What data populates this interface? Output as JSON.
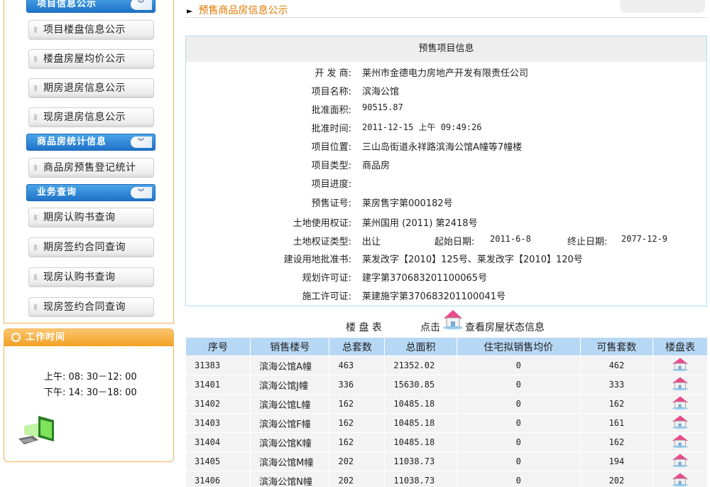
{
  "sidebar": {
    "sections": [
      {
        "title": "项目信息公示",
        "items": [
          "项目楼盘信息公示",
          "楼盘房屋均价公示",
          "期房退房信息公示",
          "现房退房信息公示"
        ]
      },
      {
        "title": "商品房统计信息",
        "items": [
          "商品房预售登记统计"
        ]
      },
      {
        "title": "业务查询",
        "items": [
          "期房认购书查询",
          "期房签约合同查询",
          "现房认购书查询",
          "现房签约合同查询"
        ]
      }
    ],
    "work_time": {
      "title": "工作时间",
      "morning": "上午: 08: 30－12: 00",
      "afternoon": "下午: 14: 30－18: 00"
    }
  },
  "main": {
    "breadcrumb": "预售商品房信息公示",
    "info": {
      "title": "预售项目信息",
      "developer_label": "开 发 商:",
      "developer": "莱州市金德电力房地产开发有限责任公司",
      "name_label": "项目名称:",
      "name": "滨海公馆",
      "area_label": "批准面积:",
      "area": "90515.87",
      "time_label": "批准时间:",
      "time": "2011-12-15 上午 09:49:26",
      "location_label": "项目位置:",
      "location": "三山岛街道永祥路滨海公馆A幢等7幢楼",
      "type_label": "项目类型:",
      "type": "商品房",
      "progress_label": "项目进度:",
      "progress": "",
      "presale_label": "预售证号:",
      "presale": "莱房售字第000182号",
      "land_cert_label": "土地使用权证:",
      "land_cert": "莱州国用 (2011) 第2418号",
      "land_type_label": "土地权证类型:",
      "land_type": "出让",
      "start_label": "起始日期:",
      "start": "2011-6-8",
      "end_label": "终止日期:",
      "end": "2077-12-9",
      "land_approval_label": "建设用地批准书:",
      "land_approval": "莱发改字【2010】125号、莱发改字【2010】120号",
      "plan_label": "规划许可证:",
      "plan": "建字第370683201100065号",
      "build_label": "施工许可证:",
      "build": "莱建施字第370683201100041号"
    },
    "table_caption": "楼 盘 表",
    "click_label": "点击",
    "click_suffix": "查看房屋状态信息",
    "columns": [
      "序号",
      "销售楼号",
      "总套数",
      "总面积",
      "住宅拟销售均价",
      "可售套数",
      "楼盘表"
    ],
    "rows": [
      [
        "31383",
        "滨海公馆A幢",
        "463",
        "21352.02",
        "0",
        "462"
      ],
      [
        "31401",
        "滨海公馆J幢",
        "336",
        "15630.85",
        "0",
        "333"
      ],
      [
        "31402",
        "滨海公馆L幢",
        "162",
        "10485.18",
        "0",
        "162"
      ],
      [
        "31403",
        "滨海公馆F幢",
        "162",
        "10485.18",
        "0",
        "161"
      ],
      [
        "31404",
        "滨海公馆K幢",
        "162",
        "10485.18",
        "0",
        "162"
      ],
      [
        "31405",
        "滨海公馆M幢",
        "202",
        "11038.73",
        "0",
        "194"
      ],
      [
        "31406",
        "滨海公馆N幢",
        "202",
        "11038.73",
        "0",
        "202"
      ]
    ]
  }
}
